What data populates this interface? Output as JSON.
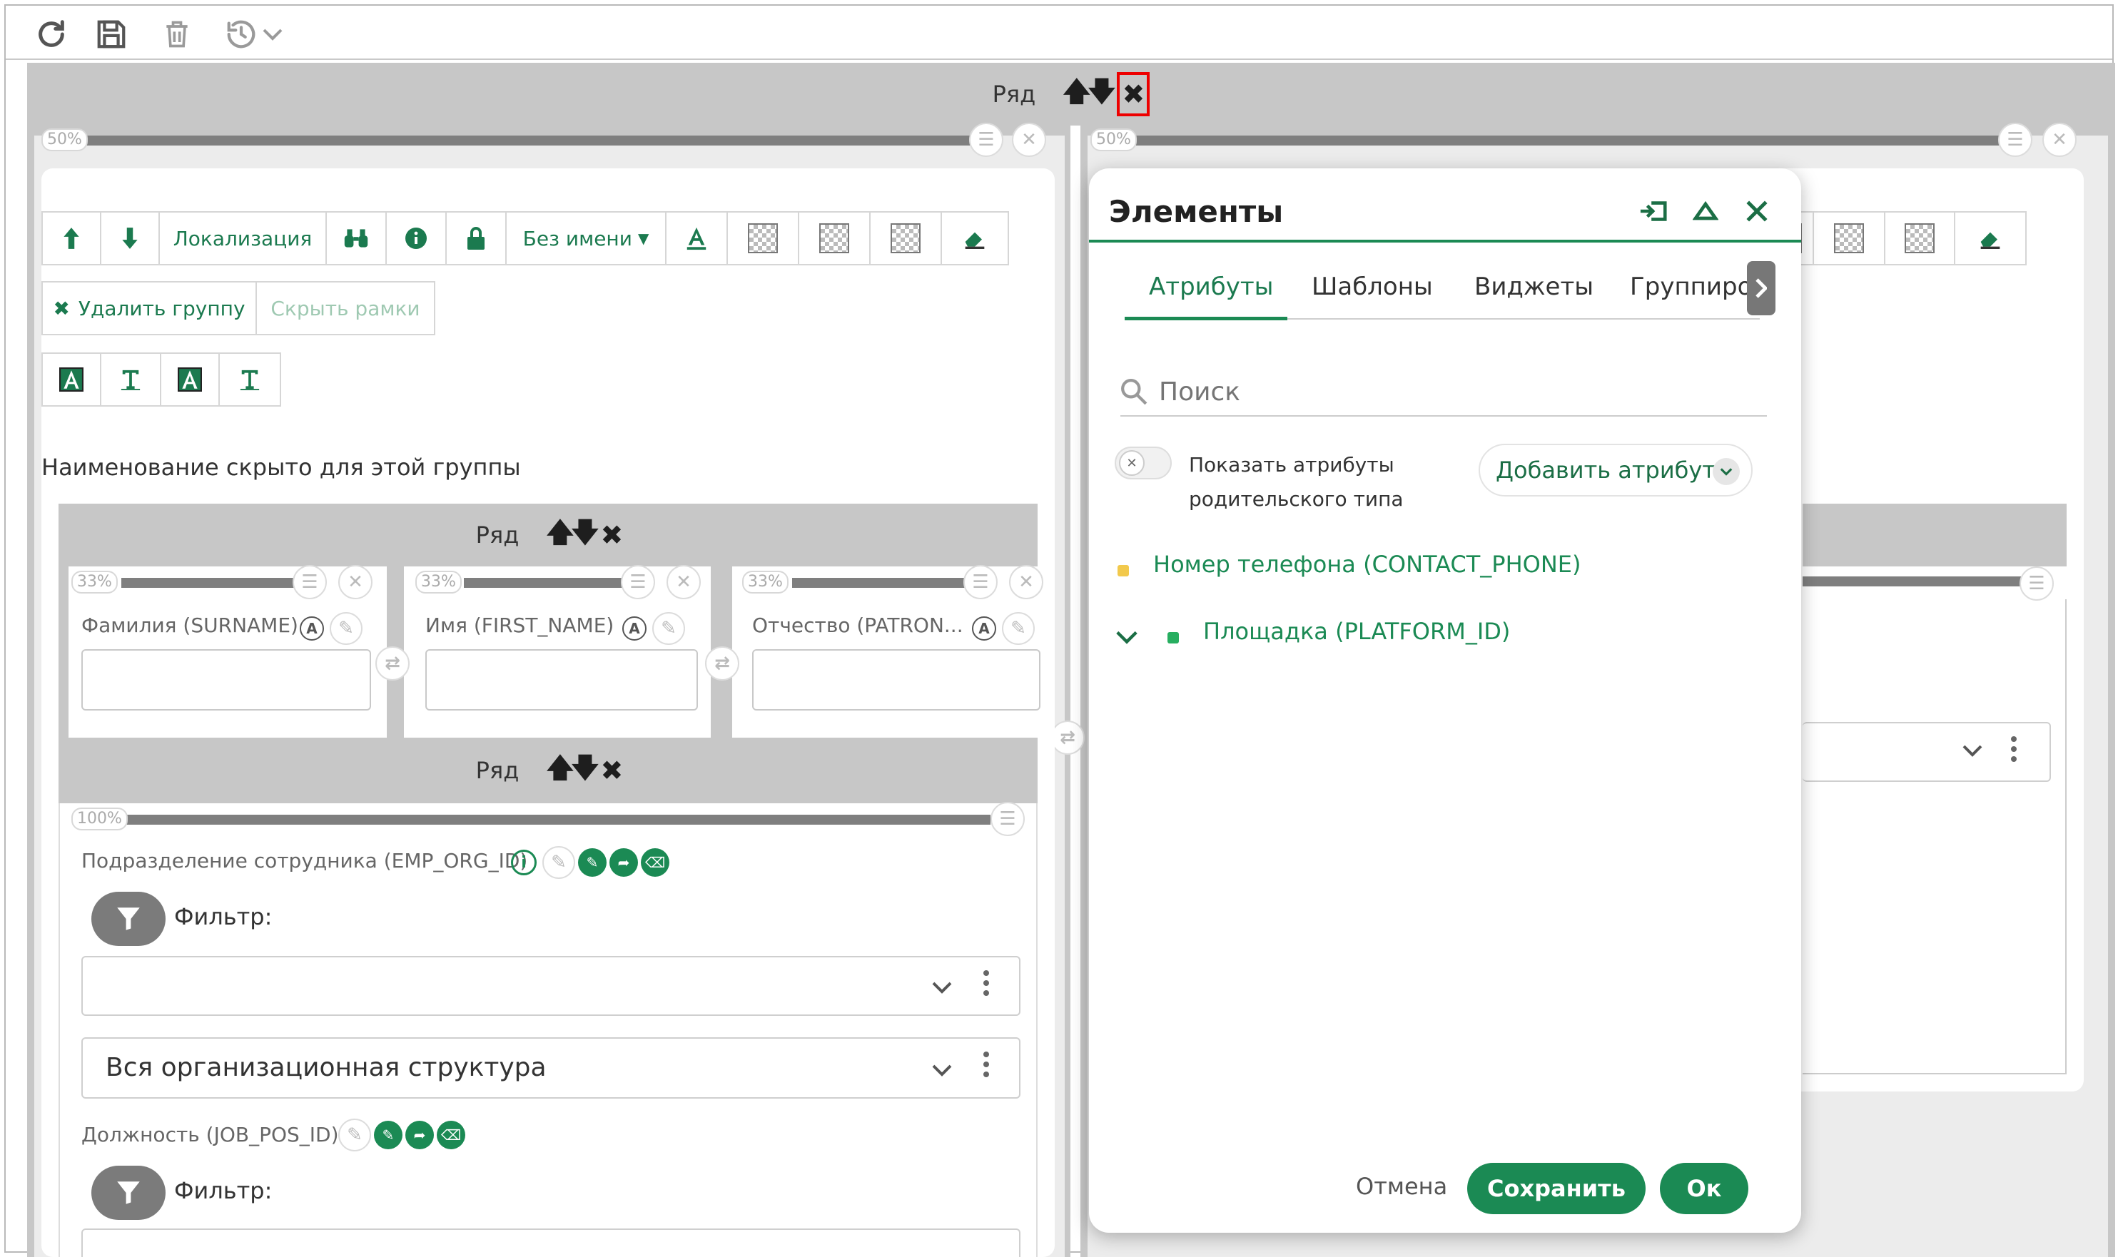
{
  "toolbar": {
    "icons": [
      "refresh-icon",
      "save-icon",
      "trash-icon",
      "history-icon",
      "chevron-down-icon"
    ]
  },
  "outer_row": {
    "label": "Ряд"
  },
  "left_col": {
    "percent": "50%"
  },
  "right_col": {
    "percent": "50%"
  },
  "group_toolbar": {
    "localization": "Локализация",
    "name_dropdown": "Без имени",
    "delete_group": "Удалить группу",
    "hide_frames": "Скрыть рамки"
  },
  "hidden_name_note": "Наименование скрыто для этой группы",
  "inner_row1": {
    "label": "Ряд",
    "cells": [
      {
        "percent": "33%",
        "field": "Фамилия (SURNAME)"
      },
      {
        "percent": "33%",
        "field": "Имя (FIRST_NAME)"
      },
      {
        "percent": "33%",
        "field": "Отчество (PATRON..."
      }
    ]
  },
  "inner_row2": {
    "label": "Ряд",
    "percent": "100%",
    "field1": "Подразделение сотрудника (EMP_ORG_ID)",
    "filter_label": "Фильтр:",
    "select2_value": "Вся организационная структура",
    "field2": "Должность (JOB_POS_ID)",
    "filter2_label": "Фильтр:"
  },
  "modal": {
    "title": "Элементы",
    "tabs": [
      "Атрибуты",
      "Шаблоны",
      "Виджеты",
      "Группиро"
    ],
    "active_tab": "Атрибуты",
    "search_placeholder": "Поиск",
    "toggle_label_line1": "Показать атрибуты",
    "toggle_label_line2": "родительского типа",
    "add_attribute": "Добавить атрибут",
    "attributes": [
      {
        "label": "Номер телефона (CONTACT_PHONE)",
        "color": "#f2c94c",
        "expandable": false
      },
      {
        "label": "Площадка (PLATFORM_ID)",
        "color": "#27ae60",
        "expandable": true
      }
    ],
    "cancel": "Отмена",
    "save": "Сохранить",
    "ok": "Ок"
  },
  "colors": {
    "accent": "#1b8a54",
    "accent_dark": "#1b7a4f",
    "grey_bar": "#c7c7c7"
  }
}
